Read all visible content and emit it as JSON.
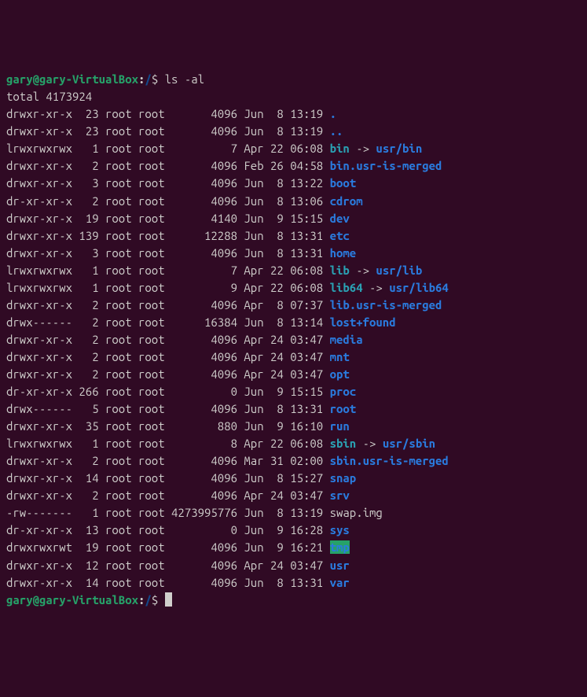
{
  "prompt": {
    "user": "gary@gary-VirtualBox",
    "colon": ":",
    "path": "/",
    "dollar": "$"
  },
  "command": "ls -al",
  "total_line": "total 4173924",
  "rows": [
    {
      "perm": "drwxr-xr-x",
      "links": " 23",
      "owner": "root",
      "group": "root",
      "size": "      4096",
      "date": "Jun  8 13:19",
      "name": ".",
      "cls": "dir",
      "arrow": "",
      "target": "",
      "tcls": ""
    },
    {
      "perm": "drwxr-xr-x",
      "links": " 23",
      "owner": "root",
      "group": "root",
      "size": "      4096",
      "date": "Jun  8 13:19",
      "name": "..",
      "cls": "dir",
      "arrow": "",
      "target": "",
      "tcls": ""
    },
    {
      "perm": "lrwxrwxrwx",
      "links": "  1",
      "owner": "root",
      "group": "root",
      "size": "         7",
      "date": "Apr 22 06:08",
      "name": "bin",
      "cls": "link",
      "arrow": " -> ",
      "target": "usr/bin",
      "tcls": "link-target"
    },
    {
      "perm": "drwxr-xr-x",
      "links": "  2",
      "owner": "root",
      "group": "root",
      "size": "      4096",
      "date": "Feb 26 04:58",
      "name": "bin.usr-is-merged",
      "cls": "dir",
      "arrow": "",
      "target": "",
      "tcls": ""
    },
    {
      "perm": "drwxr-xr-x",
      "links": "  3",
      "owner": "root",
      "group": "root",
      "size": "      4096",
      "date": "Jun  8 13:22",
      "name": "boot",
      "cls": "dir",
      "arrow": "",
      "target": "",
      "tcls": ""
    },
    {
      "perm": "dr-xr-xr-x",
      "links": "  2",
      "owner": "root",
      "group": "root",
      "size": "      4096",
      "date": "Jun  8 13:06",
      "name": "cdrom",
      "cls": "dir",
      "arrow": "",
      "target": "",
      "tcls": ""
    },
    {
      "perm": "drwxr-xr-x",
      "links": " 19",
      "owner": "root",
      "group": "root",
      "size": "      4140",
      "date": "Jun  9 15:15",
      "name": "dev",
      "cls": "dir",
      "arrow": "",
      "target": "",
      "tcls": ""
    },
    {
      "perm": "drwxr-xr-x",
      "links": "139",
      "owner": "root",
      "group": "root",
      "size": "     12288",
      "date": "Jun  8 13:31",
      "name": "etc",
      "cls": "dir",
      "arrow": "",
      "target": "",
      "tcls": ""
    },
    {
      "perm": "drwxr-xr-x",
      "links": "  3",
      "owner": "root",
      "group": "root",
      "size": "      4096",
      "date": "Jun  8 13:31",
      "name": "home",
      "cls": "dir",
      "arrow": "",
      "target": "",
      "tcls": ""
    },
    {
      "perm": "lrwxrwxrwx",
      "links": "  1",
      "owner": "root",
      "group": "root",
      "size": "         7",
      "date": "Apr 22 06:08",
      "name": "lib",
      "cls": "link",
      "arrow": " -> ",
      "target": "usr/lib",
      "tcls": "link-target"
    },
    {
      "perm": "lrwxrwxrwx",
      "links": "  1",
      "owner": "root",
      "group": "root",
      "size": "         9",
      "date": "Apr 22 06:08",
      "name": "lib64",
      "cls": "link",
      "arrow": " -> ",
      "target": "usr/lib64",
      "tcls": "link-target"
    },
    {
      "perm": "drwxr-xr-x",
      "links": "  2",
      "owner": "root",
      "group": "root",
      "size": "      4096",
      "date": "Apr  8 07:37",
      "name": "lib.usr-is-merged",
      "cls": "dir",
      "arrow": "",
      "target": "",
      "tcls": ""
    },
    {
      "perm": "drwx------",
      "links": "  2",
      "owner": "root",
      "group": "root",
      "size": "     16384",
      "date": "Jun  8 13:14",
      "name": "lost+found",
      "cls": "dir",
      "arrow": "",
      "target": "",
      "tcls": ""
    },
    {
      "perm": "drwxr-xr-x",
      "links": "  2",
      "owner": "root",
      "group": "root",
      "size": "      4096",
      "date": "Apr 24 03:47",
      "name": "media",
      "cls": "dir",
      "arrow": "",
      "target": "",
      "tcls": ""
    },
    {
      "perm": "drwxr-xr-x",
      "links": "  2",
      "owner": "root",
      "group": "root",
      "size": "      4096",
      "date": "Apr 24 03:47",
      "name": "mnt",
      "cls": "dir",
      "arrow": "",
      "target": "",
      "tcls": ""
    },
    {
      "perm": "drwxr-xr-x",
      "links": "  2",
      "owner": "root",
      "group": "root",
      "size": "      4096",
      "date": "Apr 24 03:47",
      "name": "opt",
      "cls": "dir",
      "arrow": "",
      "target": "",
      "tcls": ""
    },
    {
      "perm": "dr-xr-xr-x",
      "links": "266",
      "owner": "root",
      "group": "root",
      "size": "         0",
      "date": "Jun  9 15:15",
      "name": "proc",
      "cls": "dir",
      "arrow": "",
      "target": "",
      "tcls": ""
    },
    {
      "perm": "drwx------",
      "links": "  5",
      "owner": "root",
      "group": "root",
      "size": "      4096",
      "date": "Jun  8 13:31",
      "name": "root",
      "cls": "dir",
      "arrow": "",
      "target": "",
      "tcls": ""
    },
    {
      "perm": "drwxr-xr-x",
      "links": " 35",
      "owner": "root",
      "group": "root",
      "size": "       880",
      "date": "Jun  9 16:10",
      "name": "run",
      "cls": "dir",
      "arrow": "",
      "target": "",
      "tcls": ""
    },
    {
      "perm": "lrwxrwxrwx",
      "links": "  1",
      "owner": "root",
      "group": "root",
      "size": "         8",
      "date": "Apr 22 06:08",
      "name": "sbin",
      "cls": "link",
      "arrow": " -> ",
      "target": "usr/sbin",
      "tcls": "link-target"
    },
    {
      "perm": "drwxr-xr-x",
      "links": "  2",
      "owner": "root",
      "group": "root",
      "size": "      4096",
      "date": "Mar 31 02:00",
      "name": "sbin.usr-is-merged",
      "cls": "dir",
      "arrow": "",
      "target": "",
      "tcls": ""
    },
    {
      "perm": "drwxr-xr-x",
      "links": " 14",
      "owner": "root",
      "group": "root",
      "size": "      4096",
      "date": "Jun  8 15:27",
      "name": "snap",
      "cls": "dir",
      "arrow": "",
      "target": "",
      "tcls": ""
    },
    {
      "perm": "drwxr-xr-x",
      "links": "  2",
      "owner": "root",
      "group": "root",
      "size": "      4096",
      "date": "Apr 24 03:47",
      "name": "srv",
      "cls": "dir",
      "arrow": "",
      "target": "",
      "tcls": ""
    },
    {
      "perm": "-rw-------",
      "links": "  1",
      "owner": "root",
      "group": "root",
      "size": "4273995776",
      "date": "Jun  8 13:19",
      "name": "swap.img",
      "cls": "file",
      "arrow": "",
      "target": "",
      "tcls": ""
    },
    {
      "perm": "dr-xr-xr-x",
      "links": " 13",
      "owner": "root",
      "group": "root",
      "size": "         0",
      "date": "Jun  9 16:28",
      "name": "sys",
      "cls": "dir",
      "arrow": "",
      "target": "",
      "tcls": ""
    },
    {
      "perm": "drwxrwxrwt",
      "links": " 19",
      "owner": "root",
      "group": "root",
      "size": "      4096",
      "date": "Jun  9 16:21",
      "name": "tmp",
      "cls": "sticky",
      "arrow": "",
      "target": "",
      "tcls": ""
    },
    {
      "perm": "drwxr-xr-x",
      "links": " 12",
      "owner": "root",
      "group": "root",
      "size": "      4096",
      "date": "Apr 24 03:47",
      "name": "usr",
      "cls": "dir",
      "arrow": "",
      "target": "",
      "tcls": ""
    },
    {
      "perm": "drwxr-xr-x",
      "links": " 14",
      "owner": "root",
      "group": "root",
      "size": "      4096",
      "date": "Jun  8 13:31",
      "name": "var",
      "cls": "dir",
      "arrow": "",
      "target": "",
      "tcls": ""
    }
  ]
}
